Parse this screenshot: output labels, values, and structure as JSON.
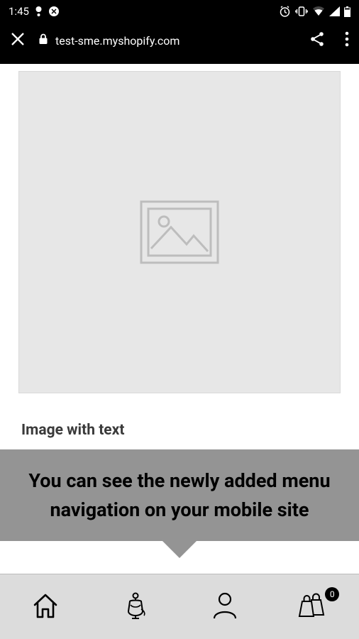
{
  "status": {
    "time": "1:45",
    "notif_icons": [
      "exclaim-icon",
      "avast-icon"
    ],
    "sys_icons": [
      "alarm-icon",
      "vibrate-icon",
      "wifi-icon",
      "cell-icon",
      "battery-icon"
    ]
  },
  "browser": {
    "url": "test-sme.myshopify.com"
  },
  "page": {
    "heading": "Image with text"
  },
  "tooltip": {
    "text": "You can see the newly added menu navigation on your mobile site"
  },
  "nav": {
    "items": [
      "home",
      "catalog",
      "account",
      "cart"
    ],
    "cart_badge": "0"
  }
}
